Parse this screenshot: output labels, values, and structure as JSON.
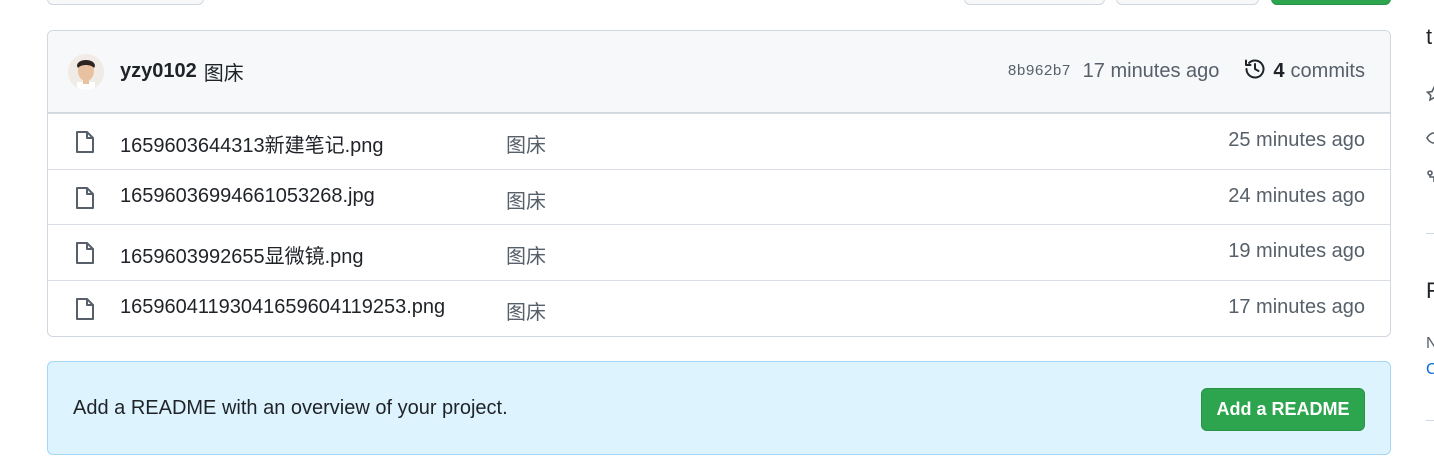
{
  "commit": {
    "author": "yzy0102",
    "message": "图床",
    "sha": "8b962b7",
    "time": "17 minutes ago",
    "history_count": "4",
    "history_label": "commits"
  },
  "files": [
    {
      "name": "1659603644313新建笔记.png",
      "commit": "图床",
      "time": "25 minutes ago"
    },
    {
      "name": "16596036994661053268.jpg",
      "commit": "图床",
      "time": "24 minutes ago"
    },
    {
      "name": "1659603992655显微镜.png",
      "commit": "图床",
      "time": "19 minutes ago"
    },
    {
      "name": "16596041193041659604119253.png",
      "commit": "图床",
      "time": "17 minutes ago"
    }
  ],
  "readme": {
    "prompt": "Add a README with an overview of your project.",
    "button_label": "Add a README"
  },
  "sidebar_partial": {
    "about_fragment": "t",
    "section_fragment": "F",
    "no_fragment": "N",
    "link_fragment": "C"
  },
  "colors": {
    "accent_green": "#2da44e",
    "readme_bg": "#ddf4ff",
    "link_blue": "#0969da"
  },
  "icons": {
    "file": "file-icon",
    "history": "history-icon",
    "star": "star-icon",
    "eye": "eye-icon",
    "fork": "fork-icon"
  }
}
